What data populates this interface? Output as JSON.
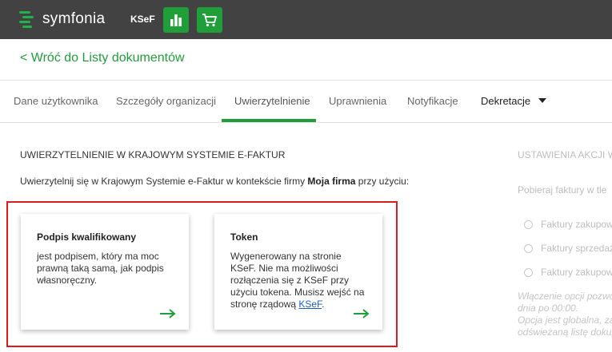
{
  "header": {
    "logo_text": "symfonia",
    "ksef_label": "KSeF",
    "buttons": [
      {
        "icon": "bar-chart-icon"
      },
      {
        "icon": "shopping-cart-icon"
      }
    ],
    "background": "#424242",
    "accent": "#1f9e3a"
  },
  "back_link": "< Wróć do Listy dokumentów",
  "tabs": [
    {
      "label": "Dane użytkownika"
    },
    {
      "label": "Szczegóły organizacji"
    },
    {
      "label": "Uwierzytelnienie",
      "active": true
    },
    {
      "label": "Uprawnienia"
    },
    {
      "label": "Notyfikacje"
    },
    {
      "label": "Dekretacje"
    }
  ],
  "auth": {
    "title": "UWIERZYTELNIENIE W KRAJOWYM SYSTEMIE E-FAKTUR",
    "desc_prefix": "Uwierzytelnij się w Krajowym Systemie e-Faktur w kontekście firmy ",
    "company": "Moja firma",
    "desc_suffix": " przy użyciu:",
    "cards": [
      {
        "title": "Podpis kwalifikowany",
        "body": "jest podpisem, który ma moc prawną taką samą, jak podpis własnoręczny."
      },
      {
        "title": "Token",
        "body_prefix": "Wygenerowany na stronie KSeF. Nie ma możliwości rozłączenia się z KSeF przy użyciu tokena. Musisz wejść na stronę rządową ",
        "link": "KSeF",
        "body_suffix": "."
      }
    ]
  },
  "right_panel": {
    "title": "USTAWIENIA AKCJI W",
    "label": "Pobieraj faktury w tle",
    "options": [
      "Faktury zakupow",
      "Faktury sprzedaż",
      "Faktury zakupow"
    ],
    "note_lines": [
      "Włączenie opcji pozwo",
      "dnia po 00:00.",
      "Opcja jest globalna, za",
      "odświeżaną listę dokum"
    ]
  }
}
